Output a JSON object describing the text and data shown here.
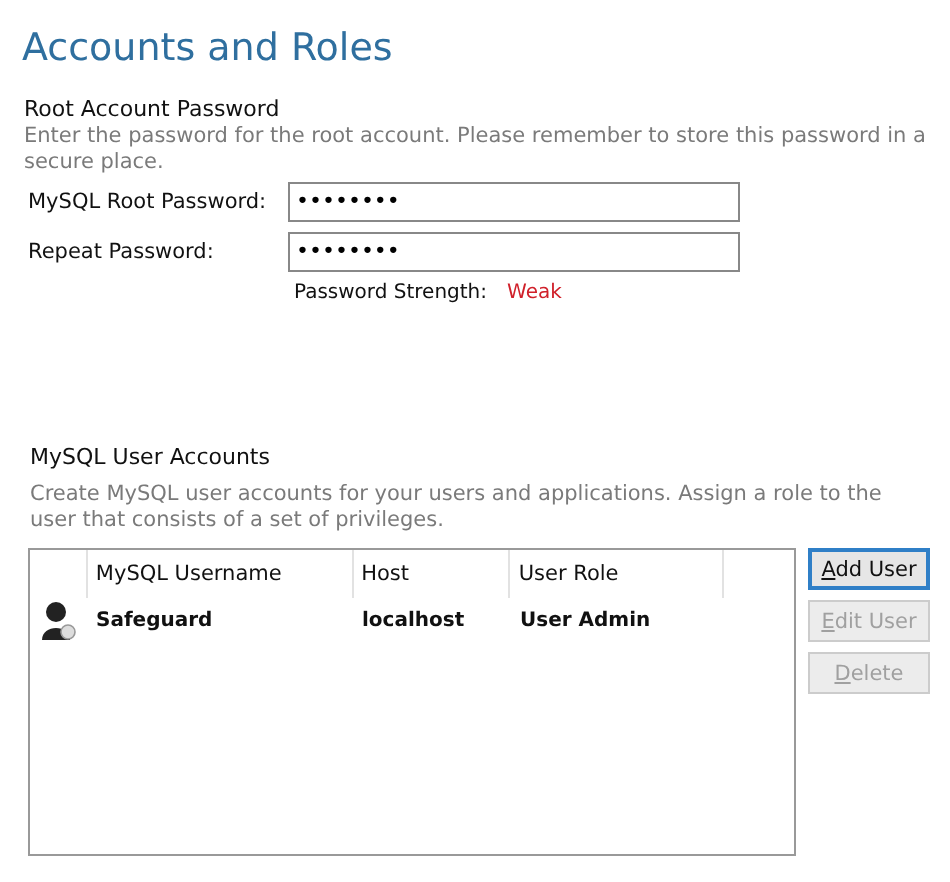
{
  "title": "Accounts and Roles",
  "root_password": {
    "heading": "Root Account Password",
    "description": "Enter the password for the root account.  Please remember to store this password in a secure place.",
    "fields": [
      {
        "label": "MySQL Root Password:",
        "value": "••••••••"
      },
      {
        "label": "Repeat Password:",
        "value": "••••••••"
      }
    ],
    "strength": {
      "label": "Password Strength:",
      "value": "Weak"
    }
  },
  "user_accounts": {
    "heading": "MySQL User Accounts",
    "description": "Create MySQL user accounts for your users and applications. Assign a role to the user that consists of a set of privileges.",
    "table": {
      "columns": [
        "MySQL Username",
        "Host",
        "User Role"
      ],
      "rows": [
        {
          "cells": [
            "Safeguard",
            "localhost",
            "User Admin"
          ],
          "selected": false
        }
      ]
    },
    "buttons": [
      {
        "label": "Add User",
        "disabled": false,
        "focused": true
      },
      {
        "label": "Edit User",
        "disabled": true,
        "focused": false
      },
      {
        "label": "Delete",
        "disabled": true,
        "focused": false
      }
    ]
  }
}
